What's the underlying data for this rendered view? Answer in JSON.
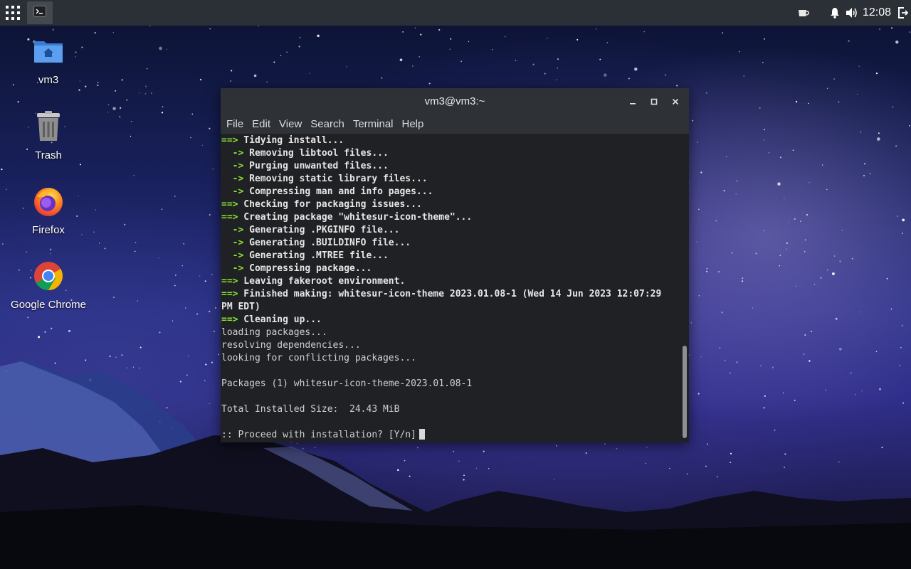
{
  "topbar": {
    "clock": "12:08",
    "icons": [
      "apps-grid-icon",
      "terminal-icon",
      "cup-icon",
      "bell-icon",
      "volume-icon",
      "logout-icon"
    ]
  },
  "desktop": {
    "icons": [
      {
        "label": "vm3",
        "icon": "home-folder-icon"
      },
      {
        "label": "Trash",
        "icon": "trash-icon"
      },
      {
        "label": "Firefox",
        "icon": "firefox-icon"
      },
      {
        "label": "Google Chrome",
        "icon": "chrome-icon"
      }
    ]
  },
  "terminal": {
    "title": "vm3@vm3:~",
    "menu": [
      "File",
      "Edit",
      "View",
      "Search",
      "Terminal",
      "Help"
    ],
    "colors": {
      "arrow": "#8ae234",
      "background": "#1f2124",
      "text": "#d0d0d0"
    },
    "lines": [
      {
        "prefix": "==>",
        "text": " Tidying install...",
        "bold": true
      },
      {
        "prefix": "  ->",
        "text": " Removing libtool files...",
        "bold": true
      },
      {
        "prefix": "  ->",
        "text": " Purging unwanted files...",
        "bold": true
      },
      {
        "prefix": "  ->",
        "text": " Removing static library files...",
        "bold": true
      },
      {
        "prefix": "  ->",
        "text": " Compressing man and info pages...",
        "bold": true
      },
      {
        "prefix": "==>",
        "text": " Checking for packaging issues...",
        "bold": true
      },
      {
        "prefix": "==>",
        "text": " Creating package \"whitesur-icon-theme\"...",
        "bold": true
      },
      {
        "prefix": "  ->",
        "text": " Generating .PKGINFO file...",
        "bold": true
      },
      {
        "prefix": "  ->",
        "text": " Generating .BUILDINFO file...",
        "bold": true
      },
      {
        "prefix": "  ->",
        "text": " Generating .MTREE file...",
        "bold": true
      },
      {
        "prefix": "  ->",
        "text": " Compressing package...",
        "bold": true
      },
      {
        "prefix": "==>",
        "text": " Leaving fakeroot environment.",
        "bold": true
      },
      {
        "prefix": "==>",
        "text": " Finished making: whitesur-icon-theme 2023.01.08-1 (Wed 14 Jun 2023 12:07:29",
        "bold": true
      },
      {
        "prefix": "",
        "text": "PM EDT)",
        "bold": true
      },
      {
        "prefix": "==>",
        "text": " Cleaning up...",
        "bold": true
      },
      {
        "prefix": "",
        "text": "loading packages...",
        "bold": false
      },
      {
        "prefix": "",
        "text": "resolving dependencies...",
        "bold": false
      },
      {
        "prefix": "",
        "text": "looking for conflicting packages...",
        "bold": false
      },
      {
        "prefix": "",
        "text": "",
        "bold": false
      },
      {
        "prefix": "",
        "text": "Packages (1) whitesur-icon-theme-2023.01.08-1",
        "bold": false
      },
      {
        "prefix": "",
        "text": "",
        "bold": false
      },
      {
        "prefix": "",
        "text": "Total Installed Size:  24.43 MiB",
        "bold": false
      },
      {
        "prefix": "",
        "text": "",
        "bold": false
      },
      {
        "prefix": "",
        "text": ":: Proceed with installation? [Y/n]",
        "bold": false,
        "cursor": true
      }
    ]
  }
}
